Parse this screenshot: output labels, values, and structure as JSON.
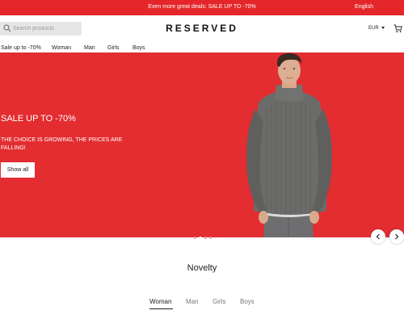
{
  "topbar": {
    "promo": "Even more great deals: SALE UP TO -70%",
    "language": "English"
  },
  "header": {
    "search_placeholder": "Search products",
    "logo": "RESERVED",
    "currency": "EUR"
  },
  "nav": {
    "items": [
      {
        "label": "Sale up to -70%"
      },
      {
        "label": "Woman"
      },
      {
        "label": "Man"
      },
      {
        "label": "Girls"
      },
      {
        "label": "Boys"
      }
    ]
  },
  "hero": {
    "title": "SALE UP TO -70%",
    "subtitle": "THE CHOICE IS GROWING, THE PRICES ARE FALLING!",
    "cta": "Show all",
    "background_color": "#e32d31",
    "slide_count": 4,
    "active_slide": 2
  },
  "section": {
    "title": "Novelty",
    "tabs": [
      {
        "label": "Woman",
        "active": true
      },
      {
        "label": "Man",
        "active": false
      },
      {
        "label": "Girls",
        "active": false
      },
      {
        "label": "Boys",
        "active": false
      }
    ]
  },
  "icons": {
    "search": "search-icon",
    "cart": "cart-icon",
    "currency_caret": "chevron-down-icon",
    "prev": "chevron-left-icon",
    "next": "chevron-right-icon"
  },
  "colors": {
    "promo_bar": "#e4262b",
    "hero": "#e32d31"
  }
}
